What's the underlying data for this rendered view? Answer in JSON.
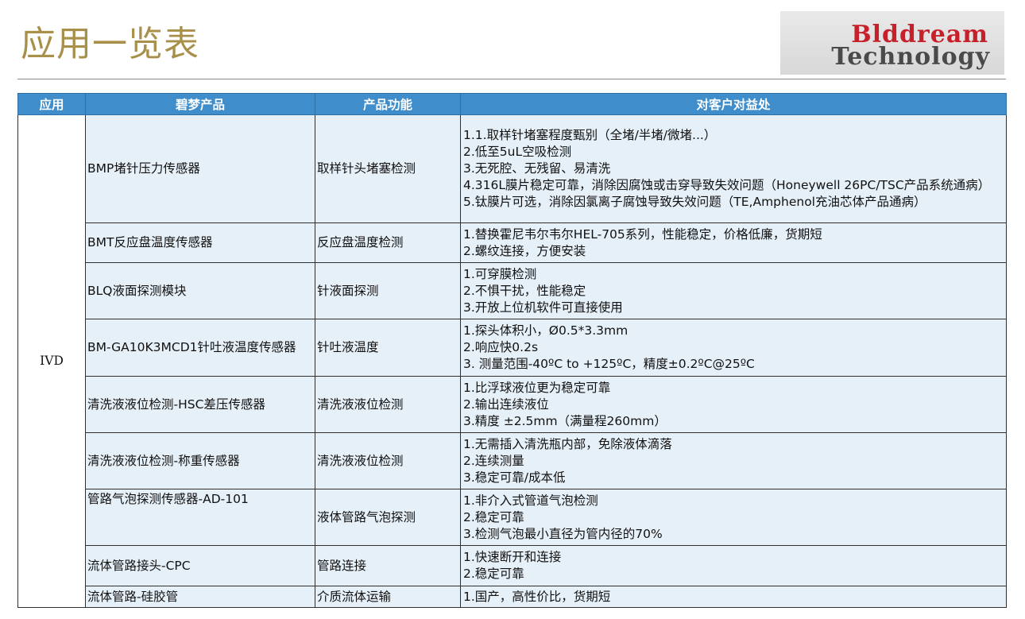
{
  "header": {
    "title": "应用一览表",
    "logo_line1": "Blddream",
    "logo_line2": "Technology"
  },
  "table": {
    "columns": [
      "应用",
      "碧梦产品",
      "产品功能",
      "对客户对益处"
    ],
    "application": "IVD",
    "rows": [
      {
        "product": "BMP堵针压力传感器",
        "function": "取样针头堵塞检测",
        "benefits": [
          "1.1.取样针堵塞程度甄别（全堵/半堵/微堵...）",
          "2.低至5uL空吸检测",
          "3.无死腔、无残留、易清洗",
          "4.316L膜片稳定可靠，消除因腐蚀或击穿导致失效问题（Honeywell 26PC/TSC产品系统通病）",
          "5.钛膜片可选，消除因氯离子腐蚀导致失效问题（TE,Amphenol充油芯体产品通病）"
        ]
      },
      {
        "product": "BMT反应盘温度传感器",
        "function": "反应盘温度检测",
        "benefits": [
          "1.替换霍尼韦尔韦尔HEL-705系列，性能稳定，价格低廉，货期短",
          "2.螺纹连接，方便安装"
        ]
      },
      {
        "product": "BLQ液面探测模块",
        "function": "针液面探测",
        "benefits": [
          "1.可穿膜检测",
          "2.不惧干扰，性能稳定",
          "3.开放上位机软件可直接使用"
        ]
      },
      {
        "product": "BM-GA10K3MCD1针吐液温度传感器",
        "function": "针吐液温度",
        "benefits": [
          "1.探头体积小，Ø0.5*3.3mm",
          "2.响应快0.2s",
          "3. 测量范围-40ºC to +125ºC，精度±0.2ºC@25ºC"
        ]
      },
      {
        "product": "清洗液液位检测-HSC差压传感器",
        "function": "清洗液液位检测",
        "benefits": [
          "1.比浮球液位更为稳定可靠",
          "2.输出连续液位",
          "3.精度 ±2.5mm（满量程260mm）"
        ]
      },
      {
        "product": "清洗液液位检测-称重传感器",
        "function": "清洗液液位检测",
        "benefits": [
          "1.无需插入清洗瓶内部，免除液体滴落",
          "2.连续测量",
          "3.稳定可靠/成本低"
        ]
      },
      {
        "product": "管路气泡探测传感器-AD-101",
        "function": "液体管路气泡探测",
        "benefits": [
          "1.非介入式管道气泡检测",
          "2.稳定可靠",
          "3.检测气泡最小直径为管内径的70%"
        ]
      },
      {
        "product": "流体管路接头-CPC",
        "function": "管路连接",
        "benefits": [
          "1.快速断开和连接",
          "2.稳定可靠"
        ]
      },
      {
        "product": "流体管路-硅胶管",
        "function": "介质流体运输",
        "benefits": [
          "1.国产，高性价比，货期短"
        ]
      }
    ]
  }
}
